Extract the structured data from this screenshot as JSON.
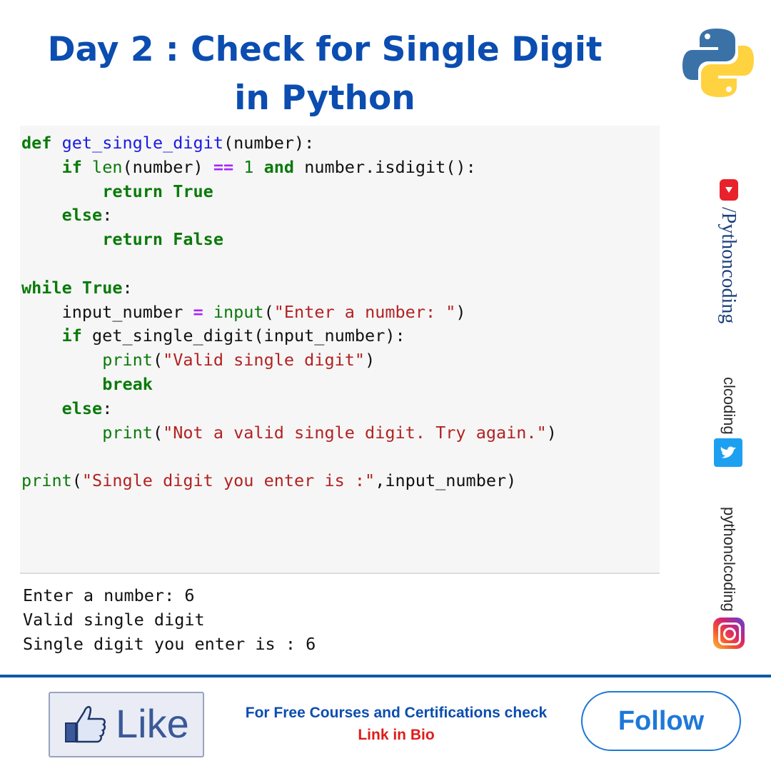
{
  "header": {
    "title_line1": "Day 2 : Check for Single Digit",
    "title_line2": "in Python",
    "logo_icon": "python-logo-icon"
  },
  "code": {
    "lines": [
      "def get_single_digit(number):",
      "    if len(number) == 1 and number.isdigit():",
      "        return True",
      "    else:",
      "        return False",
      "",
      "while True:",
      "    input_number = input(\"Enter a number: \")",
      "    if get_single_digit(input_number):",
      "        print(\"Valid single digit\")",
      "        break",
      "    else:",
      "        print(\"Not a valid single digit. Try again.\")",
      "",
      "print(\"Single digit you enter is :\",input_number)"
    ]
  },
  "output": {
    "lines": [
      "Enter a number: 6",
      "Valid single digit",
      "Single digit you enter is : 6"
    ]
  },
  "social": {
    "youtube": "/Pythoncoding",
    "twitter": "clcoding",
    "instagram": "pythonclcoding",
    "youtube_icon": "youtube-icon",
    "twitter_icon": "twitter-icon",
    "instagram_icon": "instagram-icon"
  },
  "footer": {
    "like_label": "Like",
    "promo_line1": "For Free Courses and Certifications check",
    "promo_line2": "Link in Bio",
    "follow_label": "Follow"
  },
  "colors": {
    "title": "#0b4db0",
    "keyword": "#0a7a0a",
    "string": "#b32222",
    "function_name": "#1a1ae6",
    "operator": "#aa22ff",
    "promo_red": "#e01b1b",
    "follow_blue": "#1e78d8"
  }
}
